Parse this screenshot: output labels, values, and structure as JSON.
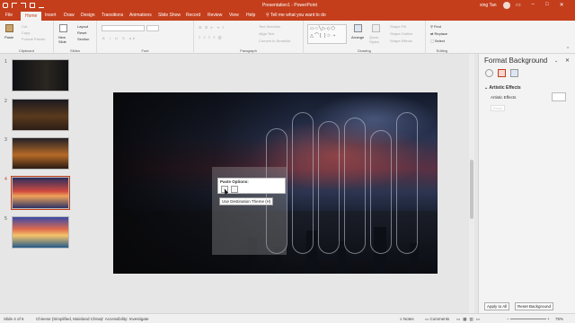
{
  "window": {
    "title": "Presentation1  -  PowerPoint",
    "user": "xing Tan"
  },
  "tabs": [
    "File",
    "Home",
    "Insert",
    "Draw",
    "Design",
    "Transitions",
    "Animations",
    "Slide Show",
    "Record",
    "Review",
    "View",
    "Help"
  ],
  "active_tab": "Home",
  "tell_me": "Tell me what you want to do",
  "ribbon": {
    "clipboard": {
      "paste": "Paste",
      "cut": "Cut",
      "copy": "Copy",
      "format_painter": "Format Painter",
      "label": "Clipboard"
    },
    "slides": {
      "new_slide": "New Slide",
      "layout": "Layout",
      "reset": "Reset",
      "section": "Section",
      "label": "Slides"
    },
    "font": {
      "label": "Font"
    },
    "paragraph": {
      "text_direction": "Text Direction",
      "align_text": "Align Text",
      "convert": "Convert to SmartArt",
      "label": "Paragraph"
    },
    "drawing": {
      "arrange": "Arrange",
      "quick_styles": "Quick Styles",
      "shape_fill": "Shape Fill",
      "shape_outline": "Shape Outline",
      "shape_effects": "Shape Effects",
      "label": "Drawing"
    },
    "editing": {
      "find": "Find",
      "replace": "Replace",
      "select": "Select",
      "label": "Editing"
    }
  },
  "thumbnails": [
    {
      "num": "1"
    },
    {
      "num": "2"
    },
    {
      "num": "3"
    },
    {
      "num": "4",
      "selected": true
    },
    {
      "num": "5"
    }
  ],
  "paste_menu": {
    "title": "Paste Options:",
    "tooltip": "Use Destination Theme (H)"
  },
  "format_pane": {
    "title": "Format Background",
    "section": "Artistic Effects",
    "effects_label": "Artistic Effects",
    "reset_label": "Reset",
    "apply_all": "Apply to All",
    "reset_background": "Reset Background"
  },
  "status": {
    "slide": "Slide 4 of 5",
    "language": "Chinese (Simplified, Mainland China)",
    "accessibility": "Accessibility: Investigate",
    "notes": "Notes",
    "comments": "Comments",
    "zoom": "75%"
  },
  "colors": {
    "accent": "#c43e1c"
  }
}
